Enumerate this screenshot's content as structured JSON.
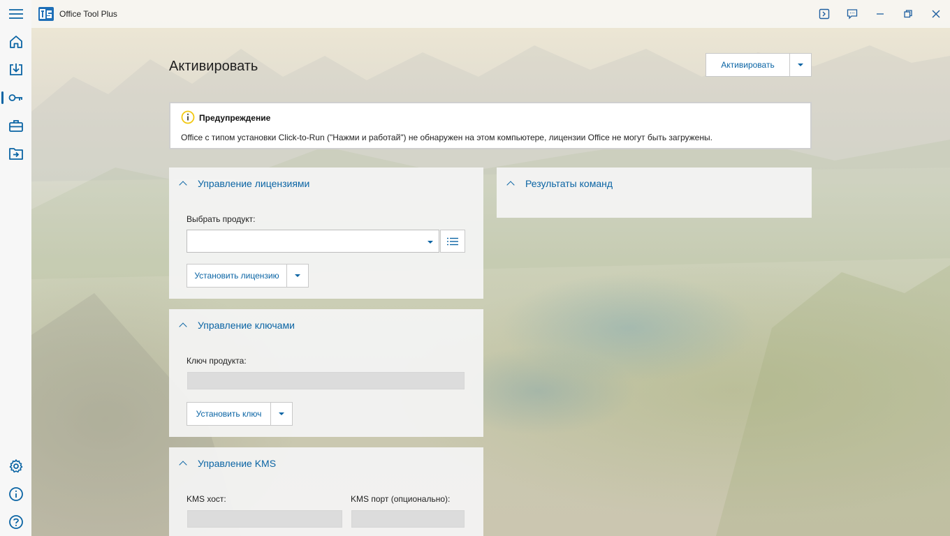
{
  "app": {
    "title": "Office Tool Plus"
  },
  "page": {
    "title": "Активировать"
  },
  "activate_button": {
    "label": "Активировать"
  },
  "warning": {
    "title": "Предупреждение",
    "text": "Office с типом установки Click-to-Run (\"Нажми и работай\") не обнаружен на этом компьютере, лицензии Office не могут быть загружены."
  },
  "license_panel": {
    "header": "Управление лицензиями",
    "select_label": "Выбрать продукт:",
    "select_value": "",
    "install_button": "Установить лицензию"
  },
  "keys_panel": {
    "header": "Управление ключами",
    "key_label": "Ключ продукта:",
    "key_value": "",
    "install_button": "Установить ключ"
  },
  "kms_panel": {
    "header": "Управление KMS",
    "host_label": "KMS хост:",
    "port_label": "KMS порт (опционально):",
    "host_value": "",
    "port_value": ""
  },
  "results_panel": {
    "header": "Результаты команд"
  },
  "sidebar": {
    "items": [
      {
        "name": "menu",
        "icon": "hamburger-icon"
      },
      {
        "name": "home",
        "icon": "home-icon"
      },
      {
        "name": "deploy",
        "icon": "download-icon"
      },
      {
        "name": "activate",
        "icon": "key-icon",
        "selected": true
      },
      {
        "name": "toolbox",
        "icon": "toolbox-icon"
      },
      {
        "name": "convert",
        "icon": "import-icon"
      },
      {
        "name": "settings",
        "icon": "gear-icon"
      },
      {
        "name": "about",
        "icon": "info-icon"
      },
      {
        "name": "help",
        "icon": "help-icon"
      }
    ]
  },
  "colors": {
    "accent": "#0a64a4",
    "warning_icon": "#f2c811"
  }
}
